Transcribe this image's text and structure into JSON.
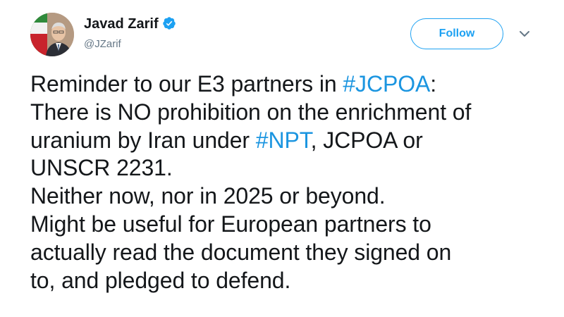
{
  "author": {
    "display_name": "Javad Zarif",
    "handle": "@JZarif",
    "verified": true,
    "verified_icon": "verified-badge-icon",
    "avatar_icon": "profile-photo"
  },
  "follow_button": {
    "label": "Follow"
  },
  "menu_icon": "chevron-down-icon",
  "tweet": {
    "lines": [
      {
        "parts": [
          {
            "text": "Reminder to our E3 partners in "
          },
          {
            "text": "#JCPOA",
            "hashtag": true
          },
          {
            "text": ":"
          }
        ]
      },
      {
        "parts": [
          {
            "text": "There is NO prohibition on the enrichment of"
          }
        ]
      },
      {
        "parts": [
          {
            "text": "uranium by Iran under "
          },
          {
            "text": "#NPT",
            "hashtag": true
          },
          {
            "text": ", JCPOA or"
          }
        ]
      },
      {
        "parts": [
          {
            "text": "UNSCR 2231."
          }
        ]
      },
      {
        "parts": [
          {
            "text": "Neither now, nor in 2025 or beyond."
          }
        ]
      },
      {
        "parts": [
          {
            "text": "Might be useful for European partners to"
          }
        ]
      },
      {
        "parts": [
          {
            "text": "actually read the document they signed on"
          }
        ]
      },
      {
        "parts": [
          {
            "text": "to, and pledged to defend."
          }
        ]
      }
    ]
  },
  "colors": {
    "accent": "#1da1f2",
    "hashtag": "#1b95e0",
    "text": "#14171a",
    "secondary_text": "#657786"
  }
}
